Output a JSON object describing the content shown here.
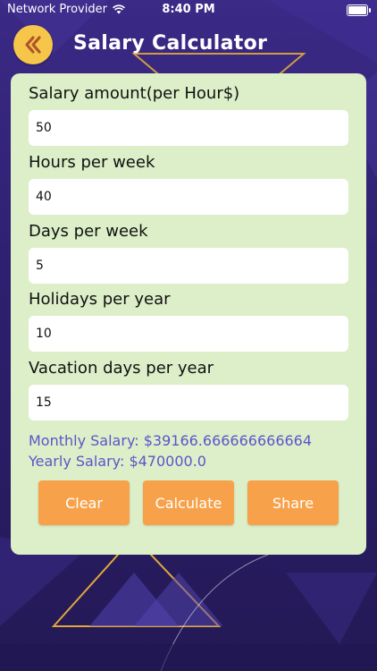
{
  "status_bar": {
    "carrier": "Network Provider",
    "time": "8:40 PM"
  },
  "header": {
    "title": "Salary Calculator",
    "back_icon": "double-chevron-left-icon"
  },
  "form": {
    "fields": [
      {
        "label": "Salary amount(per Hour$)",
        "value": "50"
      },
      {
        "label": "Hours per week",
        "value": "40"
      },
      {
        "label": "Days per week",
        "value": "5"
      },
      {
        "label": "Holidays per year",
        "value": "10"
      },
      {
        "label": "Vacation days per year",
        "value": "15"
      }
    ]
  },
  "results": {
    "monthly": "Monthly Salary: $39166.666666666664",
    "yearly": "Yearly Salary: $470000.0"
  },
  "buttons": {
    "clear": "Clear",
    "calculate": "Calculate",
    "share": "Share"
  },
  "colors": {
    "background": "#2c1f6e",
    "card": "#dcefc8",
    "button": "#f7a24a",
    "back_button": "#f6c64a",
    "result_text": "#5a55cc"
  }
}
